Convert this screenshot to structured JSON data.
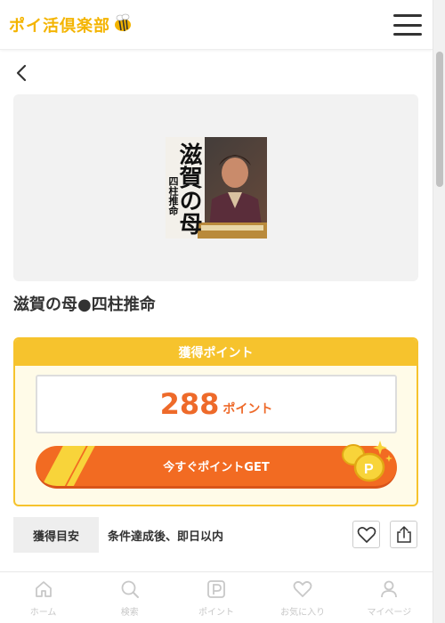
{
  "header": {
    "logo_text": "ポイ活倶楽部"
  },
  "offer": {
    "title": "滋賀の母●四柱推命",
    "thumbnail": {
      "title_text": "滋賀の母",
      "subtitle_text": "四柱推命"
    }
  },
  "points_card": {
    "header_label": "獲得ポイント",
    "value": "288",
    "unit": "ポイント",
    "get_button_label": "今すぐポイントGET"
  },
  "estimate": {
    "label": "獲得目安",
    "value": "条件達成後、即日以内"
  },
  "bottom_nav": {
    "items": [
      {
        "label": "ホーム",
        "icon": "home-icon"
      },
      {
        "label": "検索",
        "icon": "search-icon"
      },
      {
        "label": "ポイント",
        "icon": "point-icon"
      },
      {
        "label": "お気に入り",
        "icon": "heart-icon"
      },
      {
        "label": "マイページ",
        "icon": "user-icon"
      }
    ]
  },
  "colors": {
    "brand_yellow": "#f6c32d",
    "accent_orange": "#f26b22",
    "points_orange": "#ee6a2a"
  }
}
